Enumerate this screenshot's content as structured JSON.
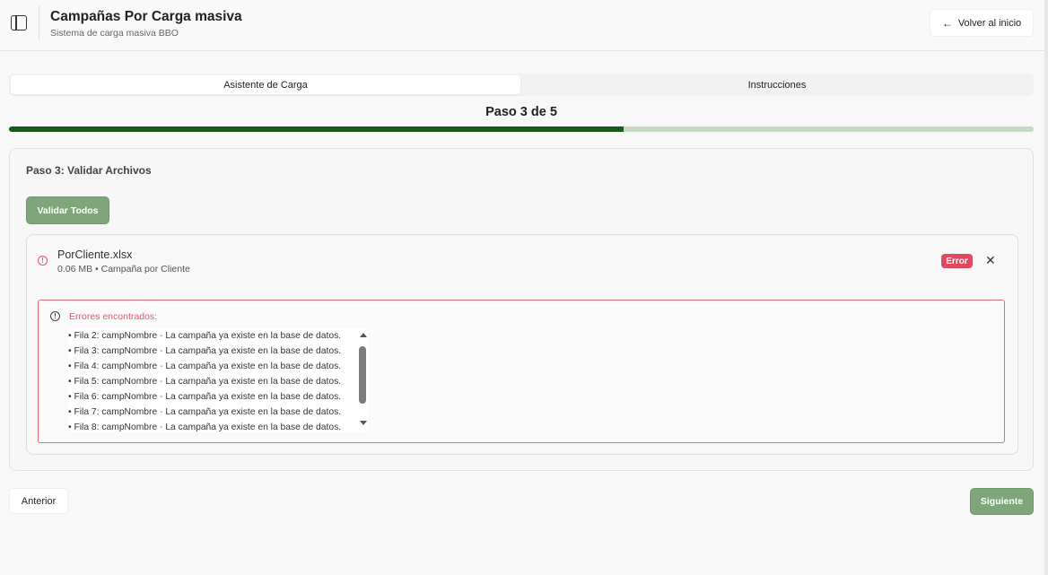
{
  "header": {
    "title": "Campañas Por Carga masiva",
    "subtitle": "Sistema de carga masiva BBO",
    "back_label": "Volver al inicio",
    "icons": [
      "sidebar-toggle-icon",
      "arrow-left-icon"
    ]
  },
  "tabs": [
    {
      "label": "Asistente de Carga",
      "active": true
    },
    {
      "label": "Instrucciones",
      "active": false
    }
  ],
  "wizard": {
    "step_label": "Paso 3 de 5",
    "current_step": 3,
    "total_steps": 5,
    "progress_fraction": 0.6
  },
  "card": {
    "title": "Paso 3: Validar Archivos",
    "validate_all_label": "Validar Todos"
  },
  "file": {
    "name": "PorCliente.xlsx",
    "meta": "0.06 MB • Campaña por Cliente",
    "status": "Error",
    "errors_title": "Errores encontrados:",
    "errors": [
      {
        "row": "• Fila 2: campNombre",
        "sep": " - ",
        "msg": "La campaña ya existe en la base de datos."
      },
      {
        "row": "• Fila 3: campNombre",
        "sep": " - ",
        "msg": "La campaña ya existe en la base de datos."
      },
      {
        "row": "• Fila 4: campNombre",
        "sep": " - ",
        "msg": "La campaña ya existe en la base de datos."
      },
      {
        "row": "• Fila 5: campNombre",
        "sep": " - ",
        "msg": "La campaña ya existe en la base de datos."
      },
      {
        "row": "• Fila 6: campNombre",
        "sep": " - ",
        "msg": "La campaña ya existe en la base de datos."
      },
      {
        "row": "• Fila 7: campNombre",
        "sep": " - ",
        "msg": "La campaña ya existe en la base de datos."
      },
      {
        "row": "• Fila 8: campNombre",
        "sep": " - ",
        "msg": "La campaña ya existe en la base de datos."
      }
    ]
  },
  "footer": {
    "prev_label": "Anterior",
    "next_label": "Siguiente"
  },
  "colors": {
    "accent_green": "#7ea67a",
    "progress_fill": "#1c5a1c",
    "progress_track": "#c9d8c6",
    "error": "#e5485e"
  }
}
